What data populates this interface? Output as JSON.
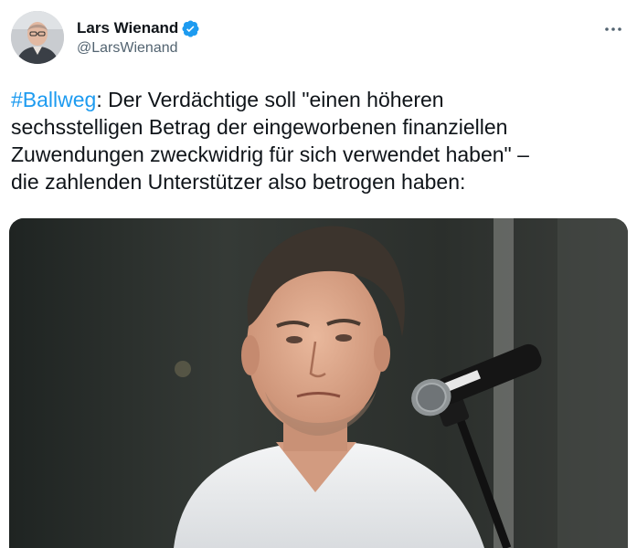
{
  "author": {
    "display_name": "Lars Wienand",
    "handle": "@LarsWienand",
    "verified": true
  },
  "tweet": {
    "hashtag": "#Ballweg",
    "line1_rest": ": Der Verdächtige soll \"einen höheren",
    "line2": "sechsstelligen Betrag der eingeworbenen finanziellen",
    "line3": "Zuwendungen zweckwidrig für sich verwendet haben\" –",
    "line4": "die zahlenden Unterstützer also betrogen haben:"
  },
  "icons": {
    "avatar": "avatar",
    "verified": "verified-badge-icon",
    "more": "more-options-icon"
  },
  "colors": {
    "accent": "#1d9bf0",
    "text": "#0f1419",
    "secondary": "#536471"
  }
}
